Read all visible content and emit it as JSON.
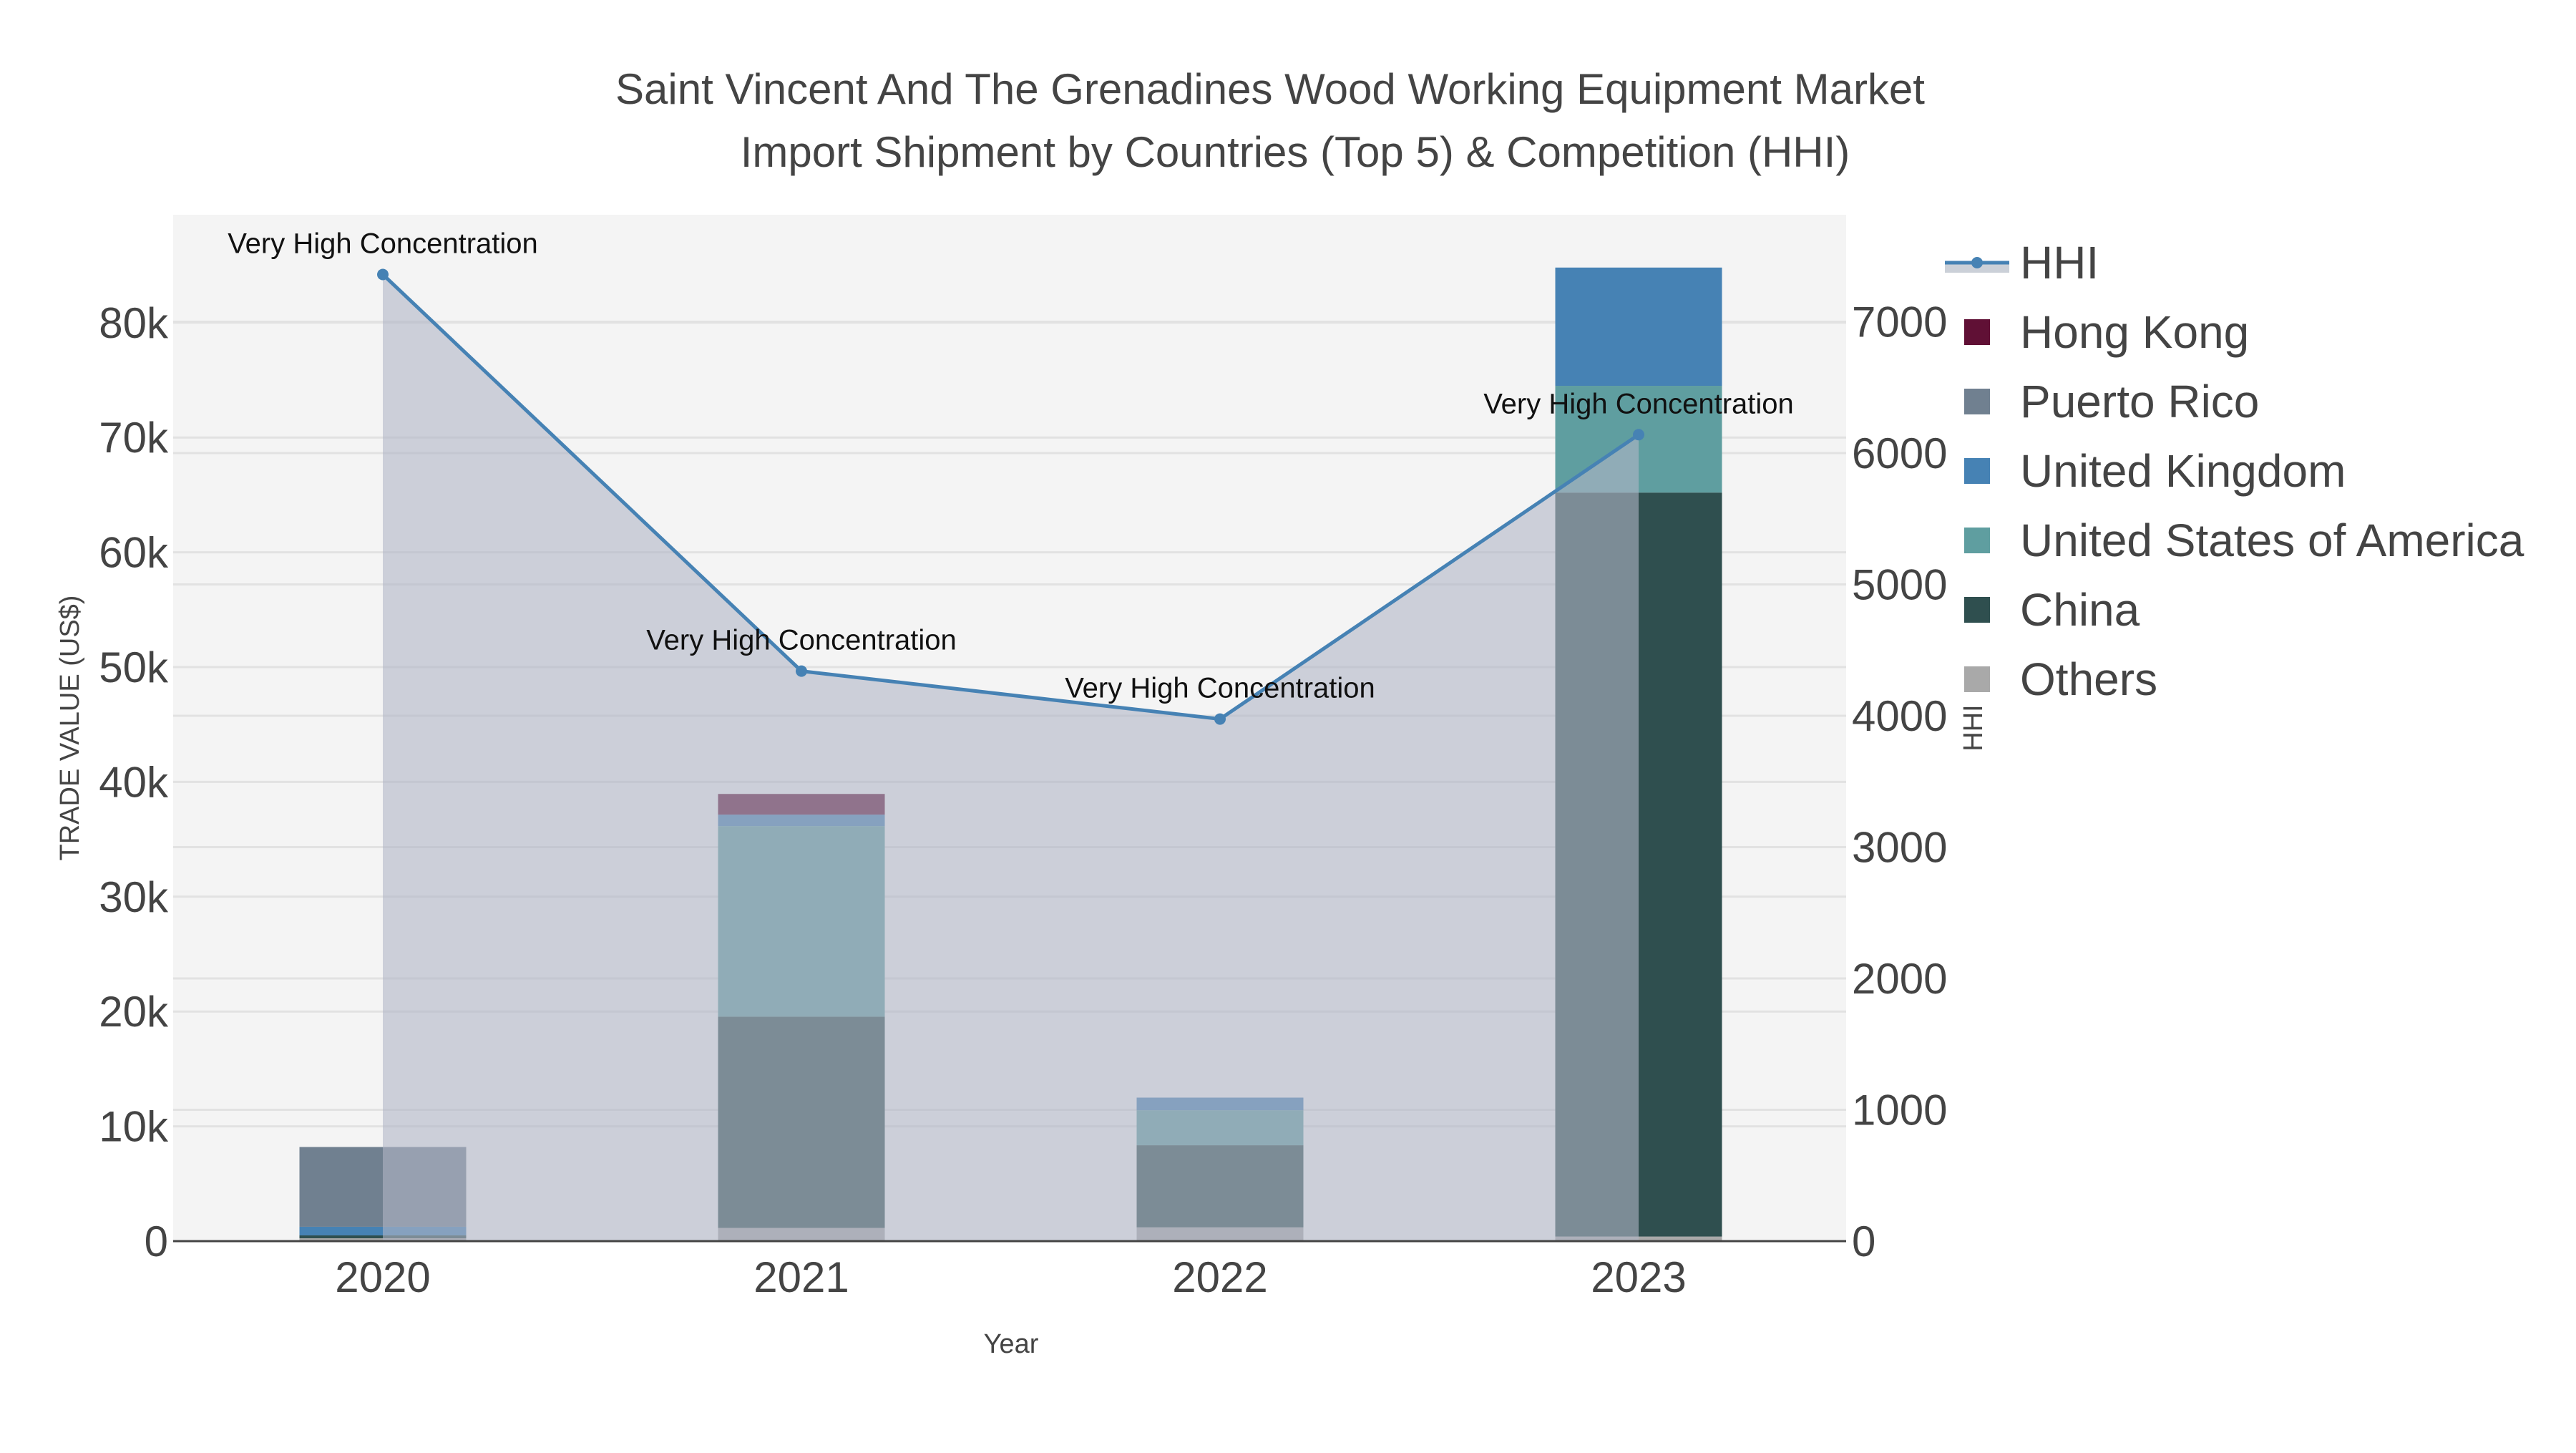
{
  "chart_data": {
    "type": "bar",
    "title_line1": "Saint Vincent And The Grenadines Wood Working Equipment Market",
    "title_line2": "Import Shipment by Countries (Top 5) & Competition (HHI)",
    "xlabel": "Year",
    "ylabel": "TRADE VALUE (US$)",
    "y2label": "HHI",
    "categories": [
      "2020",
      "2021",
      "2022",
      "2023"
    ],
    "ylim": [
      0,
      90000
    ],
    "y2lim": [
      0,
      7800
    ],
    "yticks": [
      0,
      10000,
      20000,
      30000,
      40000,
      50000,
      60000,
      70000,
      80000
    ],
    "ytick_labels": [
      "0",
      "10k",
      "20k",
      "30k",
      "40k",
      "50k",
      "60k",
      "70k",
      "80k"
    ],
    "y2ticks": [
      0,
      1000,
      2000,
      3000,
      4000,
      5000,
      6000,
      7000
    ],
    "y2tick_labels": [
      "0",
      "1000",
      "2000",
      "3000",
      "4000",
      "5000",
      "6000",
      "7000"
    ],
    "series": [
      {
        "name": "Others",
        "color": "#a9a9a9",
        "values": [
          250,
          1150,
          1200,
          400
        ]
      },
      {
        "name": "China",
        "color": "#2f4f4f",
        "values": [
          250,
          18400,
          7150,
          64800
        ]
      },
      {
        "name": "United States of America",
        "color": "#5f9ea0",
        "values": [
          0,
          16600,
          3050,
          9300
        ]
      },
      {
        "name": "United Kingdom",
        "color": "#4682b4",
        "values": [
          750,
          1000,
          1100,
          10300
        ]
      },
      {
        "name": "Puerto Rico",
        "color": "#708090",
        "values": [
          6950,
          0,
          0,
          0
        ]
      },
      {
        "name": "Hong Kong",
        "color": "#601035",
        "values": [
          0,
          1800,
          0,
          0
        ]
      }
    ],
    "hhi": {
      "name": "HHI",
      "color": "#4682b4",
      "values": [
        7360,
        4340,
        3975,
        6140
      ]
    },
    "annotations": [
      "Very High Concentration",
      "Very High Concentration",
      "Very High Concentration",
      "Very High Concentration"
    ],
    "legend": [
      "HHI",
      "Hong Kong",
      "Puerto Rico",
      "United Kingdom",
      "United States of America",
      "China",
      "Others"
    ],
    "legend_position": "right",
    "grid": true
  }
}
